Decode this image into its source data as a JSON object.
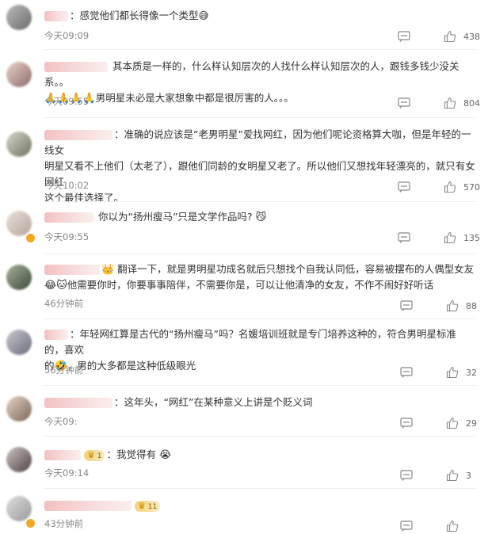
{
  "comments": [
    {
      "text": "感觉他们都长得像一个类型😅",
      "time": "今天09:09",
      "likes": "438",
      "name_w": 30
    },
    {
      "text": "其本质是一样的，什么样认知层次的人找什么样认知层次的人，跟钱多钱少没关系。。",
      "text2": "男明星未必是大家想象中都是很厉害的人。。。",
      "time": "今天09:55",
      "likes": "804"
    },
    {
      "text": "准确的说应该是“老男明星”爱找网红，因为他们呢论资格算大咖，但是年轻的一线女",
      "text2": "明星又看不上他们（太老了），跟他们同龄的女明星又老了。所以他们又想找年轻漂亮的，就只有女网红",
      "text3": "这个最佳选择了。",
      "time": "今天10:02",
      "likes": "570"
    },
    {
      "text": "你以为“扬州瘦马”只是文学作品吗?",
      "time": "今天09:55",
      "likes": "135"
    },
    {
      "text": "翻译一下，就是男明星功成名就后只想找个自我认同低，容易被摆布的人偶型女友",
      "text2": "他需要你时，你要事事陪伴，不需要你是，可以让他清净的女友，不作不闹好好听话",
      "time": "46分钟前",
      "likes": "88"
    },
    {
      "text": "年轻网红算是古代的“扬州瘦马”吗？名媛培训班就是专门培养这种的，符合男明星标准的，喜欢",
      "text2": "的",
      "text3": "，男的大多都是这种低级眼光",
      "time": "56分钟前",
      "likes": "32"
    },
    {
      "text": "这年头，“网红”在某种意义上讲是个贬义词",
      "time": "今天09:",
      "likes": "29"
    },
    {
      "text": "我觉得有",
      "time": "今天09:14",
      "likes": "3",
      "rank": "1"
    },
    {
      "text": "",
      "time": "43分钟前",
      "likes": "",
      "rank": "11"
    }
  ]
}
